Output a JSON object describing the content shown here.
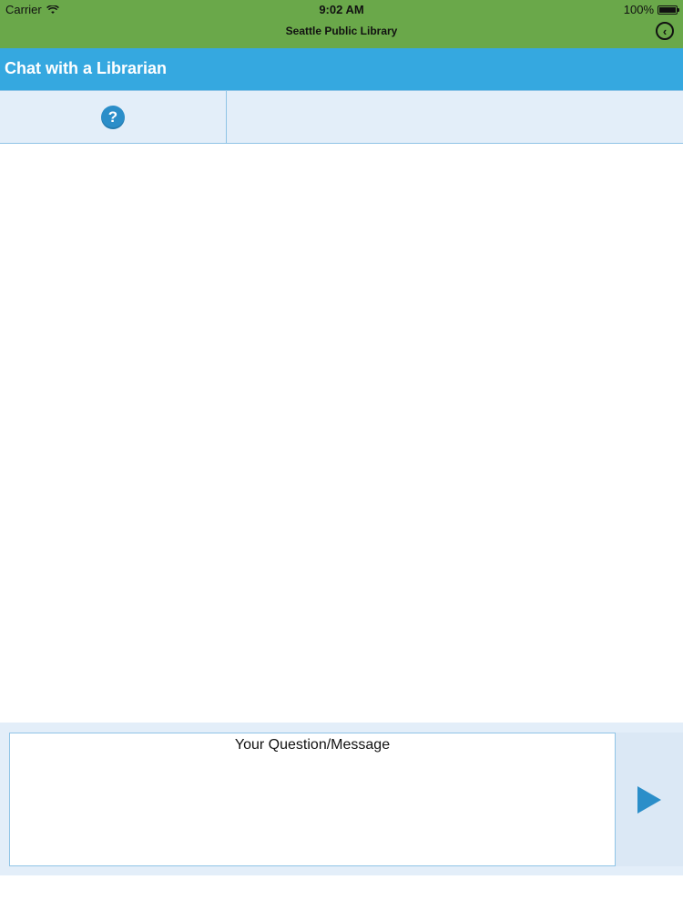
{
  "status_bar": {
    "carrier": "Carrier",
    "time": "9:02 AM",
    "battery": "100%",
    "battery_level": 1.0
  },
  "nav": {
    "title": "Seattle Public Library",
    "back_icon": "back-circle-icon"
  },
  "header": {
    "title": "Chat with a Librarian"
  },
  "toolbar": {
    "help_icon": "help-icon",
    "help_glyph": "?"
  },
  "compose": {
    "placeholder": "Your Question/Message",
    "send_icon": "send-triangle-icon"
  },
  "colors": {
    "top_bar": "#6aa84a",
    "header": "#35a8e0",
    "accent": "#2b8ec9",
    "panel": "#e3eef9",
    "border": "#8fc4e6"
  }
}
